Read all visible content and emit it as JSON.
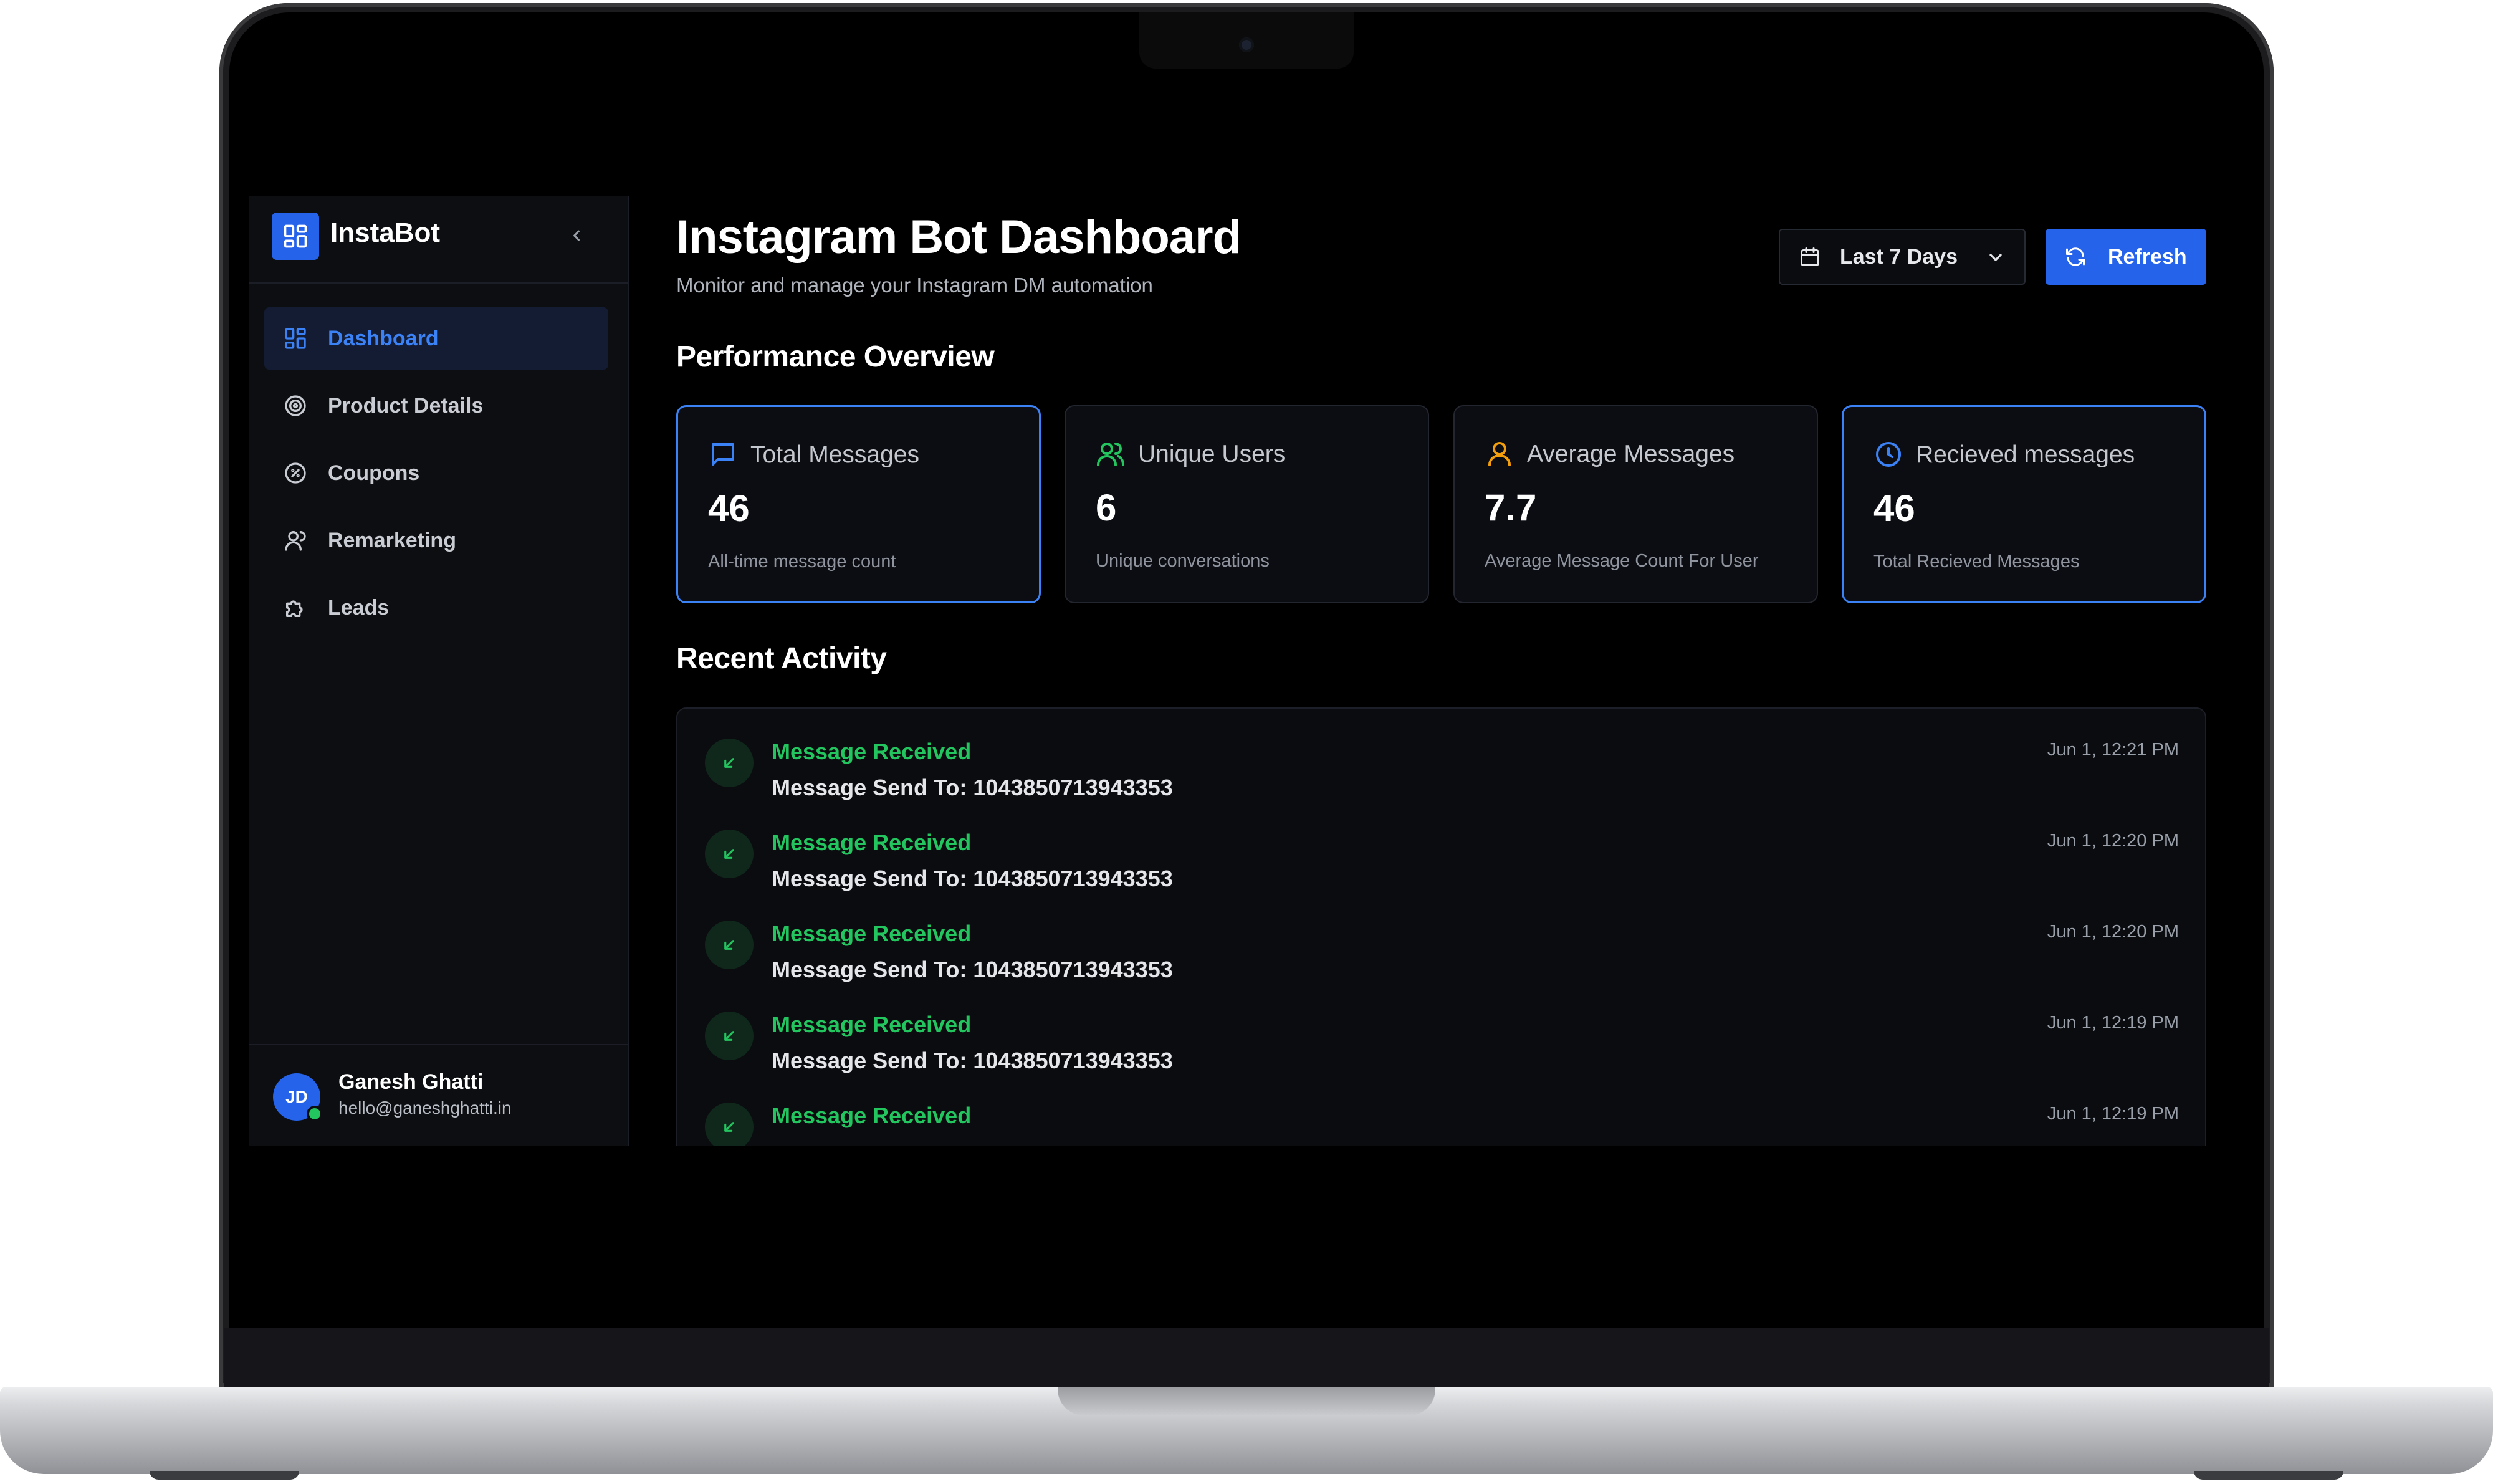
{
  "app": {
    "name": "InstaBot",
    "logo_icon": "grid-icon",
    "collapse_icon": "chevron-left-icon"
  },
  "sidebar": {
    "items": [
      {
        "label": "Dashboard",
        "icon": "dashboard-icon",
        "active": true
      },
      {
        "label": "Product Details",
        "icon": "target-icon",
        "active": false
      },
      {
        "label": "Coupons",
        "icon": "coupon-icon",
        "active": false
      },
      {
        "label": "Remarketing",
        "icon": "user-icon",
        "active": false
      },
      {
        "label": "Leads",
        "icon": "puzzle-icon",
        "active": false
      }
    ]
  },
  "user": {
    "initials": "JD",
    "name": "Ganesh Ghatti",
    "email": "hello@ganeshghatti.in",
    "status_color": "#22c55e"
  },
  "header": {
    "title": "Instagram Bot Dashboard",
    "subtitle": "Monitor and manage your Instagram DM automation",
    "range_label": "Last 7 Days",
    "refresh_label": "Refresh"
  },
  "overview": {
    "title": "Performance Overview",
    "cards": [
      {
        "label": "Total Messages",
        "value": "46",
        "note": "All-time message count",
        "icon": "message-icon",
        "icon_color": "#3b82f6",
        "highlight": true
      },
      {
        "label": "Unique Users",
        "value": "6",
        "note": "Unique conversations",
        "icon": "users-icon",
        "icon_color": "#22c55e",
        "highlight": false
      },
      {
        "label": "Average Messages",
        "value": "7.7",
        "note": "Average Message Count For User",
        "icon": "user-icon",
        "icon_color": "#f59e0b",
        "highlight": false
      },
      {
        "label": "Recieved messages",
        "value": "46",
        "note": "Total Recieved Messages",
        "icon": "clock-icon",
        "icon_color": "#3b82f6",
        "highlight": true
      }
    ]
  },
  "activity": {
    "title": "Recent Activity",
    "items": [
      {
        "title": "Message Received",
        "desc": "Message Send To: 1043850713943353",
        "time": "Jun 1, 12:21 PM"
      },
      {
        "title": "Message Received",
        "desc": "Message Send To: 1043850713943353",
        "time": "Jun 1, 12:20 PM"
      },
      {
        "title": "Message Received",
        "desc": "Message Send To: 1043850713943353",
        "time": "Jun 1, 12:20 PM"
      },
      {
        "title": "Message Received",
        "desc": "Message Send To: 1043850713943353",
        "time": "Jun 1, 12:19 PM"
      },
      {
        "title": "Message Received",
        "desc": "",
        "time": "Jun 1, 12:19 PM"
      }
    ]
  },
  "colors": {
    "accent": "#2563eb",
    "success": "#22c55e",
    "background": "#000000",
    "sidebar": "#0d0e12"
  }
}
